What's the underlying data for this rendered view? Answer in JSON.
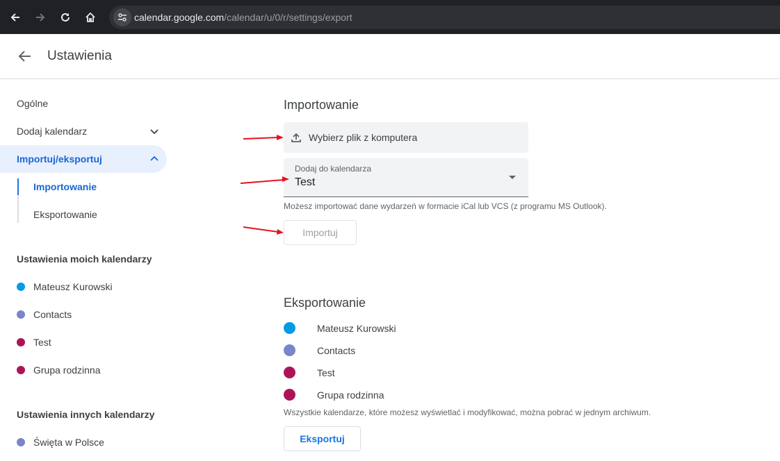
{
  "browser": {
    "url_host": "calendar.google.com",
    "url_path": "/calendar/u/0/r/settings/export"
  },
  "header": {
    "title": "Ustawienia"
  },
  "sidebar": {
    "items": [
      {
        "label": "Ogólne"
      },
      {
        "label": "Dodaj kalendarz"
      },
      {
        "label": "Importuj/eksportuj"
      }
    ],
    "subitems": [
      {
        "label": "Importowanie"
      },
      {
        "label": "Eksportowanie"
      }
    ],
    "my_calendars_heading": "Ustawienia moich kalendarzy",
    "my_calendars": [
      {
        "label": "Mateusz Kurowski",
        "color": "#039be5"
      },
      {
        "label": "Contacts",
        "color": "#7986cb"
      },
      {
        "label": "Test",
        "color": "#ad1457"
      },
      {
        "label": "Grupa rodzinna",
        "color": "#ad1457"
      }
    ],
    "other_calendars_heading": "Ustawienia innych kalendarzy",
    "other_calendars": [
      {
        "label": "Święta w Polsce",
        "color": "#7986cb"
      }
    ]
  },
  "import": {
    "title": "Importowanie",
    "file_button": "Wybierz plik z komputera",
    "select_label": "Dodaj do kalendarza",
    "select_value": "Test",
    "helper": "Możesz importować dane wydarzeń w formacie iCal lub VCS (z programu MS Outlook).",
    "button": "Importuj"
  },
  "export": {
    "title": "Eksportowanie",
    "calendars": [
      {
        "label": "Mateusz Kurowski",
        "color": "#039be5"
      },
      {
        "label": "Contacts",
        "color": "#7986cb"
      },
      {
        "label": "Test",
        "color": "#ad1457"
      },
      {
        "label": "Grupa rodzinna",
        "color": "#ad1457"
      }
    ],
    "helper": "Wszystkie kalendarze, które możesz wyświetlać i modyfikować, można pobrać w jednym archiwum.",
    "button": "Eksportuj"
  },
  "colors": {
    "accent": "#1a73e8",
    "annotation": "#e8111e"
  }
}
